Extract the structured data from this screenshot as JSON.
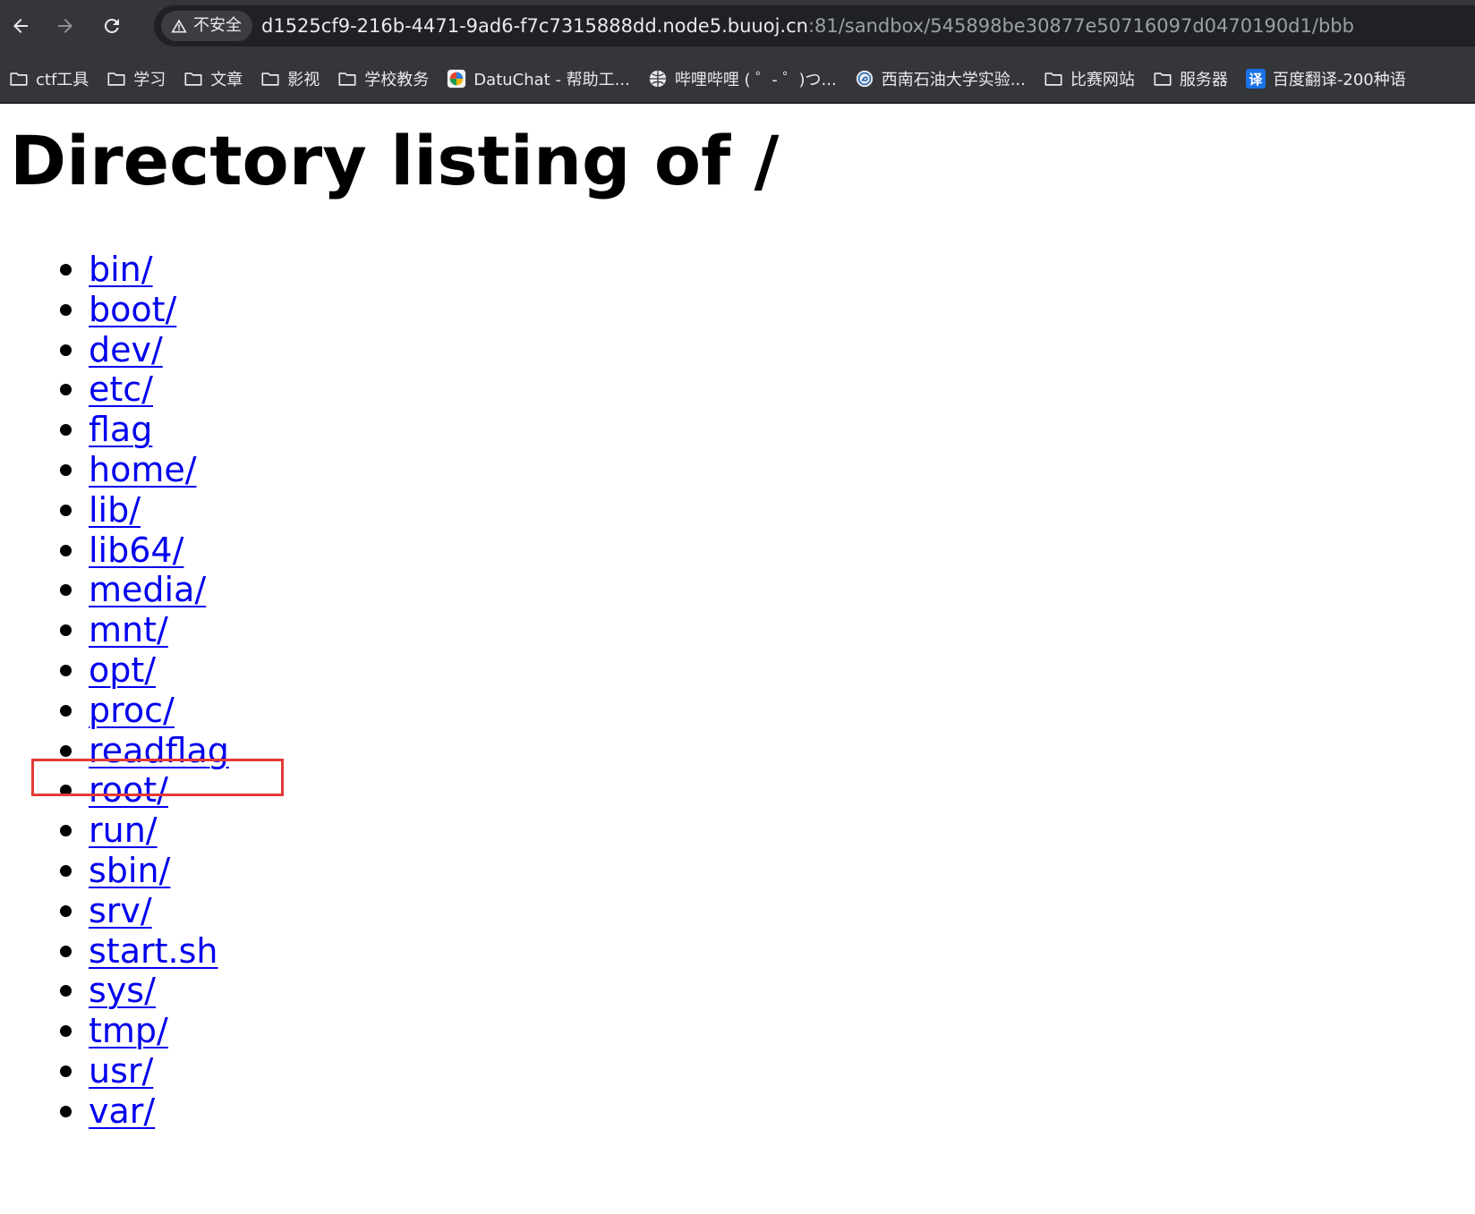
{
  "browser": {
    "security_label": "不安全",
    "url_host": "d1525cf9-216b-4471-9ad6-f7c7315888dd.node5.buuoj.cn",
    "url_rest": ":81/sandbox/545898be30877e50716097d0470190d1/bbb",
    "bookmarks": [
      {
        "label": "ctf工具",
        "icon": "folder-icon"
      },
      {
        "label": "学习",
        "icon": "folder-icon"
      },
      {
        "label": "文章",
        "icon": "folder-icon"
      },
      {
        "label": "影视",
        "icon": "folder-icon"
      },
      {
        "label": "学校教务",
        "icon": "folder-icon"
      },
      {
        "label": "DatuChat - 帮助工...",
        "icon": "datuchat-favicon"
      },
      {
        "label": "哔哩哔哩 ( ゜- ゜)つ...",
        "icon": "globe-favicon"
      },
      {
        "label": "西南石油大学实验...",
        "icon": "school-favicon"
      },
      {
        "label": "比赛网站",
        "icon": "folder-icon"
      },
      {
        "label": "服务器",
        "icon": "folder-icon"
      },
      {
        "label": "百度翻译-200种语",
        "icon": "translate-favicon",
        "badge": "译"
      }
    ]
  },
  "page": {
    "title": "Directory listing of /",
    "entries": [
      "bin/",
      "boot/",
      "dev/",
      "etc/",
      "flag",
      "home/",
      "lib/",
      "lib64/",
      "media/",
      "mnt/",
      "opt/",
      "proc/",
      "readflag",
      "root/",
      "run/",
      "sbin/",
      "srv/",
      "start.sh",
      "sys/",
      "tmp/",
      "usr/",
      "var/"
    ],
    "highlighted_entry": "readflag",
    "highlight_color": "#e53935",
    "link_color": "#0000ee"
  }
}
